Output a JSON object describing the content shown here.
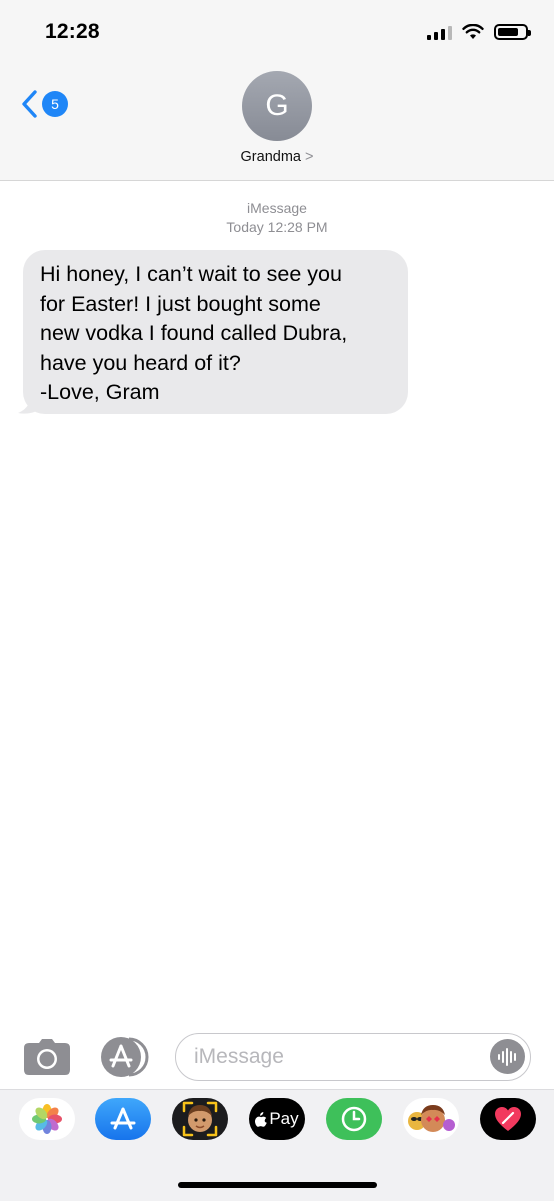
{
  "status_bar": {
    "time": "12:28"
  },
  "header": {
    "back_badge": "5",
    "avatar_initial": "G",
    "contact_name": "Grandma",
    "contact_arrow": ">"
  },
  "thread": {
    "service": "iMessage",
    "timestamp": "Today 12:28 PM",
    "message_lines": [
      "Hi honey, I can’t wait to see you",
      "for Easter! I just bought some",
      "new vodka I found called Dubra,",
      "have you heard of it?",
      "-Love, Gram"
    ]
  },
  "composer": {
    "placeholder": "iMessage"
  },
  "app_drawer": {
    "apple_pay_label": "Pay",
    "apps": [
      "photos-icon",
      "app-store-icon",
      "memoji-icon",
      "apple-pay-icon",
      "activity-icon",
      "animoji-icon",
      "digital-touch-icon"
    ]
  },
  "colors": {
    "accent": "#1f86f7",
    "bubble": "#e9e9eb",
    "placeholder": "#b7b7bb"
  }
}
